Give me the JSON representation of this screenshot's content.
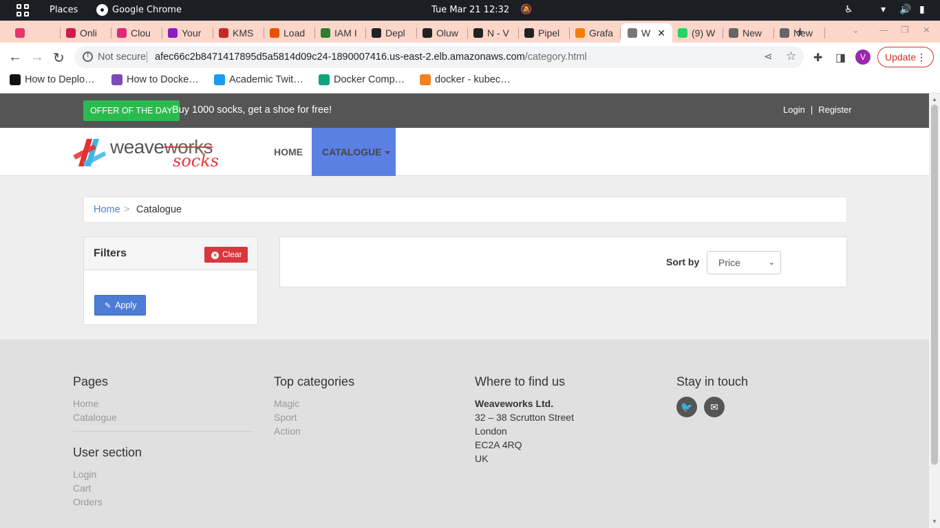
{
  "system_bar": {
    "places": "Places",
    "app_name": "Google Chrome",
    "clock": "Tue Mar 21  12:32"
  },
  "tabs": [
    {
      "label": "",
      "color": "#e5366c"
    },
    {
      "label": "Onli",
      "color": "#d11a4b"
    },
    {
      "label": "Clou",
      "color": "#e0277a"
    },
    {
      "label": "Your",
      "color": "#8a1cc0"
    },
    {
      "label": "KMS",
      "color": "#c62828"
    },
    {
      "label": "Load",
      "color": "#e65100"
    },
    {
      "label": "IAM I",
      "color": "#2e7d32"
    },
    {
      "label": "Depl",
      "color": "#222222"
    },
    {
      "label": "Oluw",
      "color": "#222222"
    },
    {
      "label": "N - V",
      "color": "#222222"
    },
    {
      "label": "Pipel",
      "color": "#222222"
    },
    {
      "label": "Grafa",
      "color": "#f57c00"
    },
    {
      "label": "W",
      "color": "#777777",
      "active": true
    },
    {
      "label": "(9) W",
      "color": "#25d366"
    },
    {
      "label": "New",
      "color": "#666666"
    },
    {
      "label": "New",
      "color": "#666666"
    }
  ],
  "omnibox": {
    "security": "Not secure",
    "host": "afec66c2b8471417895d5a5814d09c24-1890007416.us-east-2.elb.amazonaws.com",
    "path": "/category.html"
  },
  "account_initial": "V",
  "update_label": "Update",
  "bookmarks": [
    {
      "label": "How to Deplo…",
      "color": "#111111"
    },
    {
      "label": "How to Docke…",
      "color": "#7b4bb7"
    },
    {
      "label": "Academic Twit…",
      "color": "#1d9bf0"
    },
    {
      "label": "Docker Comp…",
      "color": "#10a37f"
    },
    {
      "label": "docker - kubec…",
      "color": "#f48024"
    }
  ],
  "site": {
    "offer_badge": "OFFER OF THE DAY",
    "offer_text": "Buy 1000 socks, get a shoe for free!",
    "login": "Login",
    "register": "Register",
    "logo_main": "weave",
    "logo_struck": "works",
    "logo_sub": "socks",
    "nav_home": "HOME",
    "nav_catalogue": "CATALOGUE",
    "breadcrumb_home": "Home",
    "breadcrumb_sep": ">",
    "breadcrumb_current": "Catalogue",
    "filters_title": "Filters",
    "clear_label": "Clear",
    "apply_label": "Apply",
    "sort_label": "Sort by",
    "sort_value": "Price"
  },
  "footer": {
    "pages_title": "Pages",
    "pages_links": [
      "Home",
      "Catalogue"
    ],
    "user_title": "User section",
    "user_links": [
      "Login",
      "Cart",
      "Orders"
    ],
    "top_title": "Top categories",
    "top_links": [
      "Magic",
      "Sport",
      "Action"
    ],
    "where_title": "Where to find us",
    "company": "Weaveworks Ltd.",
    "address": [
      "32 – 38 Scrutton Street",
      "London",
      "EC2A 4RQ",
      "UK"
    ],
    "stay_title": "Stay in touch"
  }
}
